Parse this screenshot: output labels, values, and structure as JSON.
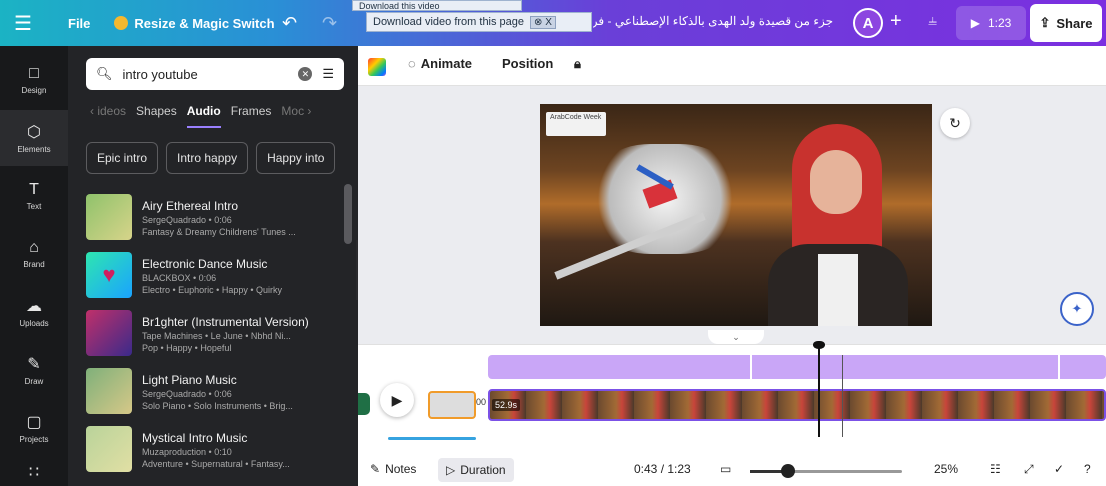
{
  "topbar": {
    "file_label": "File",
    "resize_label": "Resize & Magic Switch",
    "title": "جزء من قصيدة ولد الهدى بالذكاء الإصطناعي - فريق",
    "avatar_initial": "A",
    "play_time": "1:23",
    "share_label": "Share",
    "icons": [
      "menu-icon",
      "crown-icon",
      "undo-icon",
      "redo-icon",
      "plus-icon",
      "analytics-icon",
      "play-icon",
      "share-icon"
    ]
  },
  "browser_overlay": {
    "download_small": "Download this video",
    "download_main": "Download video from this page",
    "close_label": "⊗ X"
  },
  "rail": {
    "items": [
      {
        "label": "Design",
        "icon": "design-icon",
        "glyph": "□"
      },
      {
        "label": "Elements",
        "icon": "elements-icon",
        "glyph": "⬡"
      },
      {
        "label": "Text",
        "icon": "text-icon",
        "glyph": "T"
      },
      {
        "label": "Brand",
        "icon": "brand-icon",
        "glyph": "⌂"
      },
      {
        "label": "Uploads",
        "icon": "uploads-icon",
        "glyph": "☁"
      },
      {
        "label": "Draw",
        "icon": "draw-icon",
        "glyph": "✎"
      },
      {
        "label": "Projects",
        "icon": "projects-icon",
        "glyph": "▢"
      }
    ],
    "active": "Elements"
  },
  "panel": {
    "search_value": "intro youtube",
    "tabs": [
      "ideos",
      "Shapes",
      "Audio",
      "Frames",
      "Moc"
    ],
    "active_tab": "Audio",
    "chips": [
      "Epic intro",
      "Intro happy",
      "Happy into"
    ],
    "items": [
      {
        "title": "Airy Ethereal Intro",
        "sub1": "SergeQuadrado • 0:06",
        "sub2": "Fantasy & Dreamy Childrens' Tunes ..."
      },
      {
        "title": "Electronic Dance Music",
        "sub1": "BLACKBOX • 0:06",
        "sub2": "Electro • Euphoric • Happy • Quirky"
      },
      {
        "title": "Br1ghter (Instrumental Version)",
        "sub1": "Tape Machines • Le June • Nbhd Ni...",
        "sub2": "Pop • Happy • Hopeful"
      },
      {
        "title": "Light Piano Music",
        "sub1": "SergeQuadrado • 0:06",
        "sub2": "Solo Piano • Solo Instruments • Brig..."
      },
      {
        "title": "Mystical Intro Music",
        "sub1": "Muzaproduction • 0:10",
        "sub2": "Adventure • Supernatural • Fantasy..."
      }
    ],
    "thumb_colors": [
      "#a8c87a",
      "#2ee6b0",
      "#c0306a",
      "#9fb67a",
      "#c7d49a"
    ]
  },
  "editor": {
    "animate_label": "Animate",
    "position_label": "Position",
    "stage_badge": "ArabCode Week",
    "clip_duration": "52.9s",
    "clip_gap_label": "00"
  },
  "footer": {
    "notes_label": "Notes",
    "duration_label": "Duration",
    "time_display": "0:43 / 1:23",
    "zoom_label": "25%",
    "zoom_fraction": 0.25
  },
  "timeline": {
    "progress_fraction": 0.518
  }
}
